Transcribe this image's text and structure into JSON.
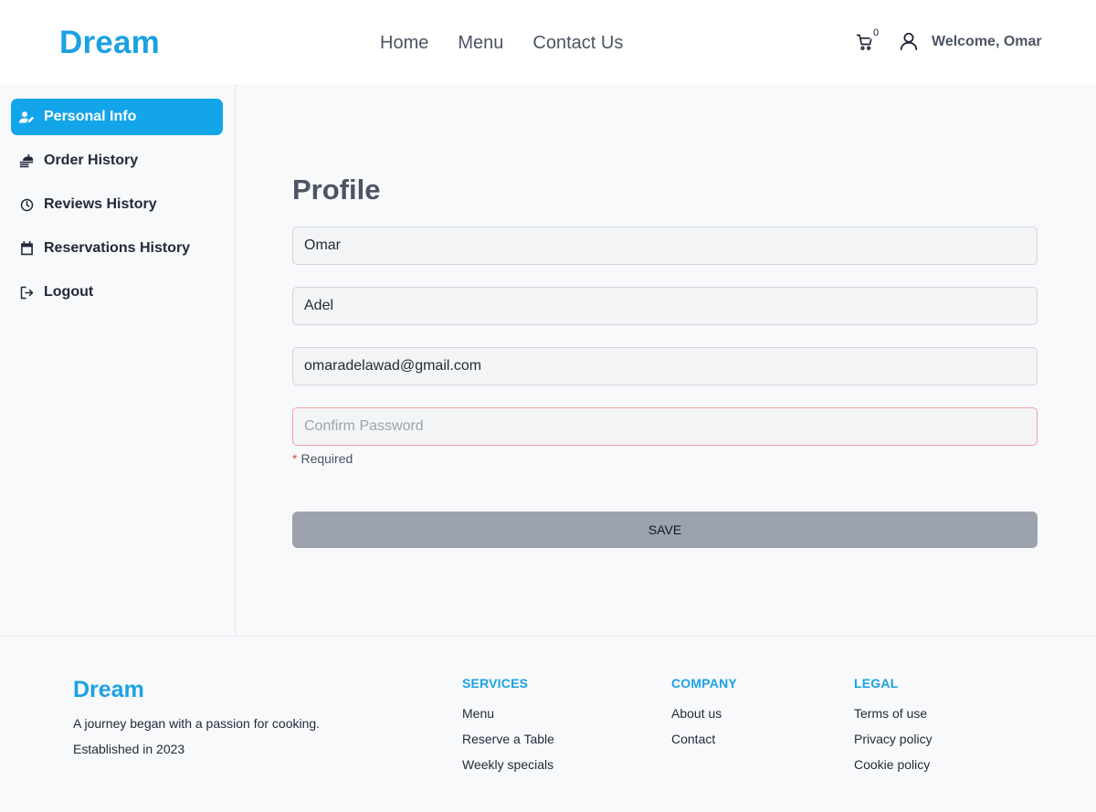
{
  "header": {
    "logo": "Dream",
    "nav": [
      "Home",
      "Menu",
      "Contact Us"
    ],
    "cart_count": "0",
    "welcome": "Welcome, Omar"
  },
  "sidebar": {
    "items": [
      {
        "label": "Personal Info",
        "icon": "user-edit-icon",
        "active": true
      },
      {
        "label": "Order History",
        "icon": "food-tray-icon",
        "active": false
      },
      {
        "label": "Reviews History",
        "icon": "clock-icon",
        "active": false
      },
      {
        "label": "Reservations History",
        "icon": "calendar-icon",
        "active": false
      },
      {
        "label": "Logout",
        "icon": "logout-icon",
        "active": false
      }
    ]
  },
  "profile": {
    "title": "Profile",
    "first_name": "Omar",
    "last_name": "Adel",
    "email": "omaradelawad@gmail.com",
    "confirm_password_placeholder": "Confirm Password",
    "required_text": "Required",
    "save_label": "SAVE"
  },
  "footer": {
    "logo": "Dream",
    "tagline": "A journey began with a passion for cooking.",
    "established": "Established in 2023",
    "services": {
      "heading": "SERVICES",
      "links": [
        "Menu",
        "Reserve a Table",
        "Weekly specials"
      ]
    },
    "company": {
      "heading": "COMPANY",
      "links": [
        "About us",
        "Contact"
      ]
    },
    "legal": {
      "heading": "LEGAL",
      "links": [
        "Terms of use",
        "Privacy policy",
        "Cookie policy"
      ]
    }
  },
  "colors": {
    "brand": "#1ba1e2",
    "active_sidebar": "#12a5ea",
    "save_button": "#9ca3af",
    "error_border": "#f3a0a0",
    "required_star": "#e04848"
  }
}
